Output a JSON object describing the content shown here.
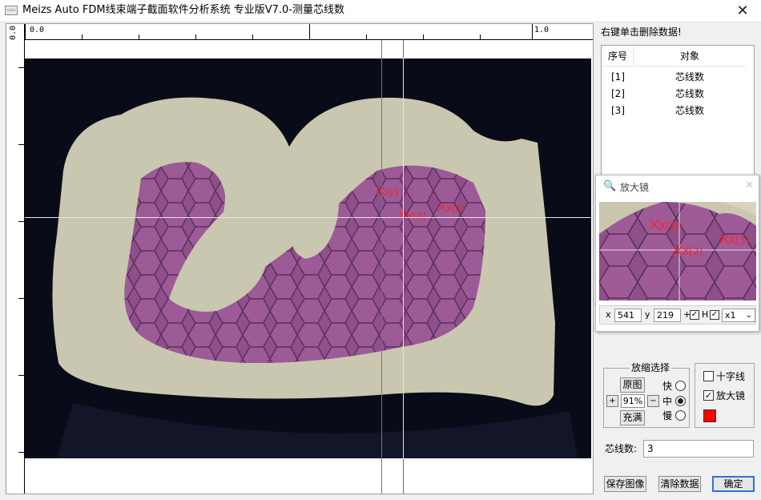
{
  "window": {
    "title": "Meizs Auto FDM线束端子截面软件分析系统 专业版V7.0-测量芯线数",
    "icon": "app-icon",
    "close": "✕"
  },
  "ruler": {
    "top_start": "0.0",
    "top_end": "1.0",
    "left_start": "0.0"
  },
  "panel": {
    "hint": "右键单击删除数据!",
    "list_headers": [
      "序号",
      "对象"
    ],
    "rows": [
      {
        "index": "[1]",
        "object": "芯线数"
      },
      {
        "index": "[2]",
        "object": "芯线数"
      },
      {
        "index": "[3]",
        "object": "芯线数"
      }
    ]
  },
  "markers": [
    "X[1]",
    "X[2]",
    "X[3]"
  ],
  "magnifier": {
    "title": "放大镜",
    "close": "✕",
    "x_label": "x",
    "x_value": "541",
    "y_label": "y",
    "y_value": "219",
    "plus_label": "+",
    "h_label": "H",
    "check_mark": "✓",
    "zoom_select": "x1"
  },
  "zoom": {
    "legend": "放缩选择",
    "original": "原图",
    "percent": "91%",
    "fill": "充满",
    "zoom_in": "+",
    "zoom_out": "−",
    "speeds": [
      "快",
      "中",
      "慢"
    ],
    "selected_speed": "中"
  },
  "options": {
    "crosshair_label": "十字线",
    "crosshair_checked": false,
    "magnifier_label": "放大镜",
    "magnifier_checked": true,
    "check_mark": "✓",
    "color": "#ff0000"
  },
  "count": {
    "label": "芯线数:",
    "value": "3"
  },
  "buttons": {
    "save": "保存图像",
    "clear": "清除数据",
    "ok": "确定"
  },
  "colors": {
    "strand": "#8e4f8a",
    "metal": "#c9c7b0",
    "background": "#0a0b18",
    "marker": "#ff2020"
  }
}
